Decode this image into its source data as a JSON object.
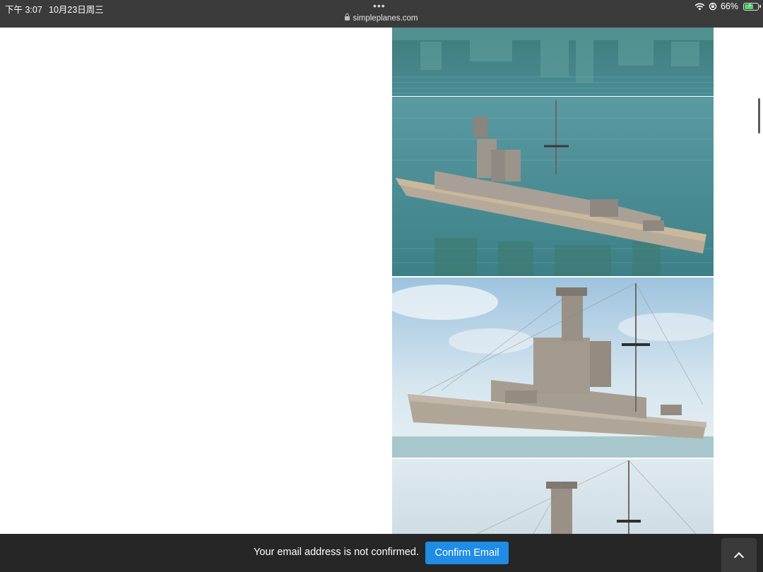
{
  "status_bar": {
    "time": "下午 3:07",
    "date": "10月23日周三",
    "url": "simpleplanes.com",
    "battery": "66%",
    "battery_level": 0.66,
    "icons": [
      "wifi-icon",
      "orientation-lock-icon",
      "battery-charging-icon",
      "lock-icon",
      "more-dots-icon"
    ]
  },
  "images": [
    {
      "name": "water-reflection-image"
    },
    {
      "name": "battleship-top-view-image"
    },
    {
      "name": "battleship-side-view-image"
    },
    {
      "name": "battleship-partial-image"
    }
  ],
  "bottom_bar": {
    "notice": "Your email address is not confirmed.",
    "confirm_label": "Confirm Email"
  },
  "colors": {
    "status_bar_bg": "#3b3b3b",
    "bottom_bar_bg": "#262626",
    "confirm_button": "#1f8ce6",
    "battery_green": "#4cd964"
  }
}
